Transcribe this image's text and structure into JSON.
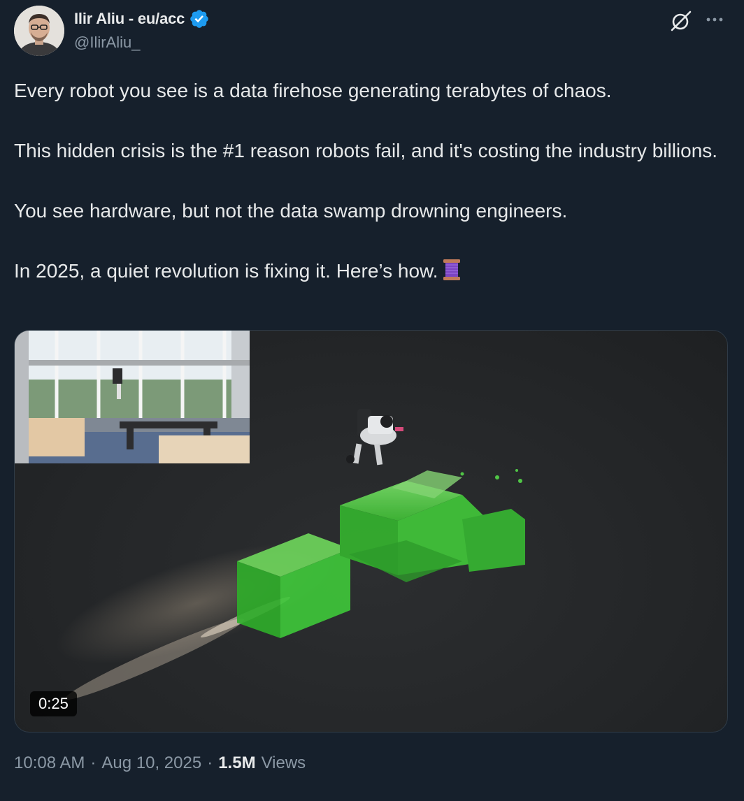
{
  "author": {
    "name": "Ilir Aliu - eu/acc",
    "handle": "@IlirAliu_",
    "verified": true,
    "avatar_icon": "avatar-photo"
  },
  "header_icons": [
    "grok-icon",
    "more-icon"
  ],
  "tweet": {
    "paragraphs": [
      "Every robot you see is a data firehose generating terabytes of chaos.",
      "This hidden crisis is the #1 reason robots fail, and it's costing the industry billions.",
      "You see hardware, but not the data swamp drowning engineers.",
      "In 2025, a quiet revolution is fixing it. Here’s how."
    ],
    "trailing_emoji": "thread-spool-icon"
  },
  "media": {
    "type": "video",
    "duration": "0:25"
  },
  "meta": {
    "time": "10:08 AM",
    "separator": "·",
    "date": "Aug 10, 2025",
    "views_count": "1.5M",
    "views_label": "Views"
  },
  "colors": {
    "background": "#16202c",
    "text_primary": "#e7e9ea",
    "text_secondary": "#8b98a5",
    "verified_badge": "#1d9bf0",
    "point_cloud_green": "#3fcf3f"
  }
}
